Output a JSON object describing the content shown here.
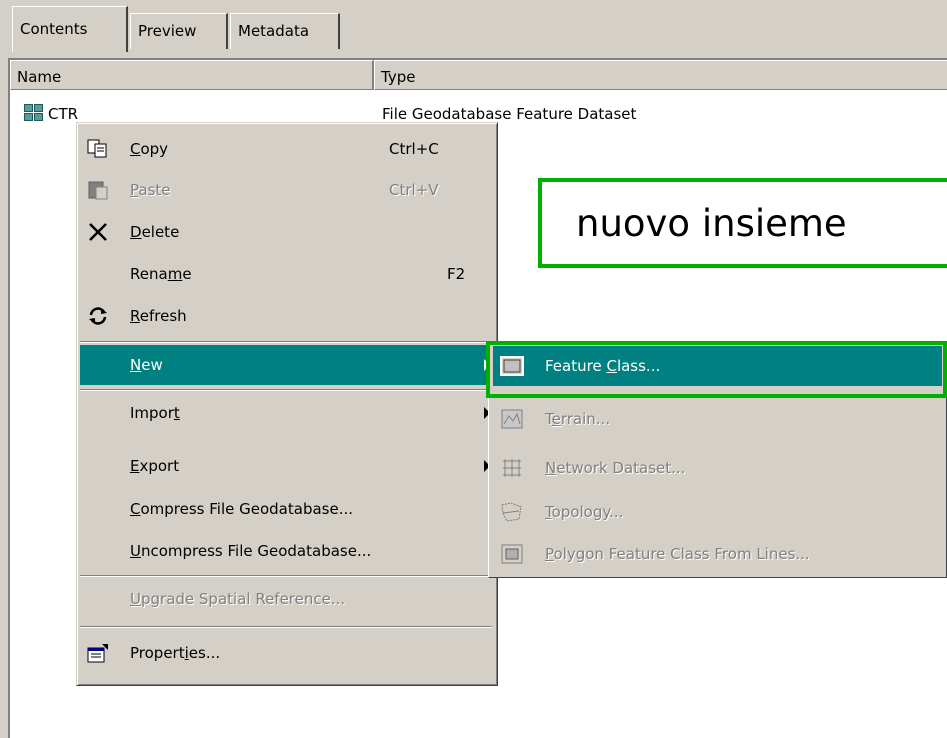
{
  "tabs": [
    {
      "label": "Contents",
      "active": true
    },
    {
      "label": "Preview",
      "active": false
    },
    {
      "label": "Metadata",
      "active": false
    }
  ],
  "columns": {
    "name": "Name",
    "type": "Type"
  },
  "rows": [
    {
      "name": "CTR",
      "type": "File Geodatabase Feature Dataset",
      "icon": "feature-dataset-icon"
    }
  ],
  "context_menu": {
    "items": [
      {
        "label": "Copy",
        "accel": "C",
        "shortcut": "Ctrl+C",
        "icon": "copy-icon",
        "enabled": true
      },
      {
        "label": "Paste",
        "accel": "P",
        "shortcut": "Ctrl+V",
        "icon": "paste-icon",
        "enabled": false
      },
      {
        "label": "Delete",
        "accel": "D",
        "shortcut": "",
        "icon": "delete-icon",
        "enabled": true
      },
      {
        "label": "Rename",
        "accel": "m",
        "shortcut": "F2",
        "icon": "",
        "enabled": true
      },
      {
        "label": "Refresh",
        "accel": "R",
        "shortcut": "",
        "icon": "refresh-icon",
        "enabled": true
      },
      {
        "label": "New",
        "accel": "N",
        "submenu": true,
        "highlighted": true,
        "enabled": true
      },
      {
        "label": "Import",
        "accel": "t",
        "submenu": true,
        "enabled": true
      },
      {
        "label": "Export",
        "accel": "E",
        "submenu": true,
        "enabled": true
      },
      {
        "label": "Compress File Geodatabase...",
        "accel": "C",
        "enabled": true
      },
      {
        "label": "Uncompress File Geodatabase...",
        "accel": "U",
        "enabled": true
      },
      {
        "label": "Upgrade Spatial Reference...",
        "accel": "U",
        "enabled": false
      },
      {
        "label": "Properties...",
        "accel": "i",
        "icon": "properties-icon",
        "enabled": true
      }
    ]
  },
  "new_submenu": {
    "items": [
      {
        "label": "Feature Class...",
        "icon": "feature-class-icon",
        "enabled": true,
        "highlighted": true
      },
      {
        "label": "Terrain...",
        "icon": "terrain-icon",
        "enabled": false
      },
      {
        "label": "Network Dataset...",
        "icon": "network-dataset-icon",
        "enabled": false
      },
      {
        "label": "Topology...",
        "icon": "topology-icon",
        "enabled": false
      },
      {
        "label": "Polygon Feature Class From Lines...",
        "icon": "polygon-from-lines-icon",
        "enabled": false
      }
    ]
  },
  "annotation": {
    "text": "nuovo insieme",
    "color": "#00b000"
  },
  "colors": {
    "highlight": "#008080",
    "chrome": "#d4d0c8"
  }
}
